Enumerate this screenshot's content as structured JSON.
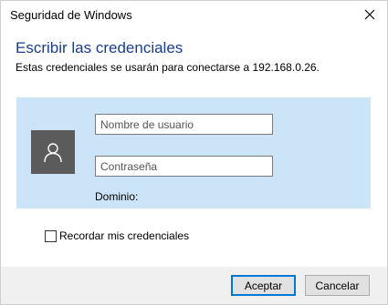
{
  "window": {
    "title": "Seguridad de Windows"
  },
  "dialog": {
    "heading": "Escribir las credenciales",
    "subheading": "Estas credenciales se usarán para conectarse a 192.168.0.26."
  },
  "credentials": {
    "username_placeholder": "Nombre de usuario",
    "password_placeholder": "Contraseña",
    "domain_label": "Dominio:"
  },
  "remember": {
    "label": "Recordar mis credenciales",
    "checked": false
  },
  "buttons": {
    "accept": "Aceptar",
    "cancel": "Cancelar"
  },
  "colors": {
    "heading": "#1a3e8c",
    "panel": "#cce4f7",
    "avatar": "#5b5b5b",
    "accent": "#0078d7"
  }
}
